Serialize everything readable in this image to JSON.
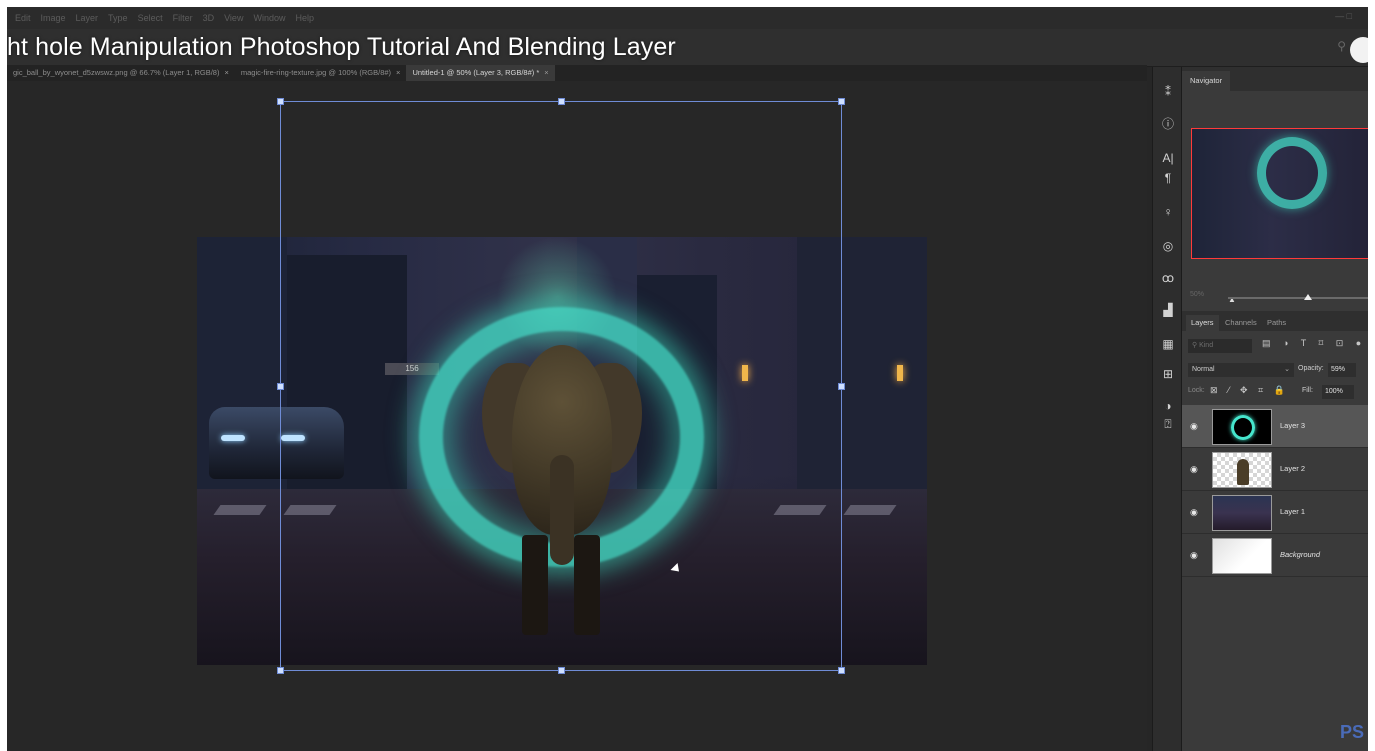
{
  "menu": [
    "Edit",
    "Image",
    "Layer",
    "Type",
    "Select",
    "Filter",
    "3D",
    "View",
    "Window",
    "Help"
  ],
  "window_controls": "— □",
  "video_title": "ht hole Manipulation Photoshop Tutorial And Blending Layer",
  "tabs": [
    {
      "label": "gic_ball_by_wyonet_d5zwswz.png @ 66.7% (Layer 1, RGB/8)",
      "close": "×",
      "active": false
    },
    {
      "label": "magic-fire-ring-texture.jpg @ 100% (RGB/8#)",
      "close": "×",
      "active": false
    },
    {
      "label": "Untitled-1 @ 50% (Layer 3, RGB/8#) *",
      "close": "×",
      "active": true
    }
  ],
  "canvas": {
    "street_sign": "156"
  },
  "tools": [
    {
      "icon": "history-icon",
      "glyph": "⁑"
    },
    {
      "icon": "info-icon",
      "glyph": "ⓘ"
    },
    {
      "icon": "character-icon",
      "glyph": "A|"
    },
    {
      "icon": "paragraph-icon",
      "glyph": "¶"
    },
    {
      "icon": "learn-icon",
      "glyph": "♀"
    },
    {
      "icon": "libraries-icon",
      "glyph": "◎"
    },
    {
      "icon": "adjust-icon",
      "glyph": "ꝏ"
    },
    {
      "icon": "histogram-icon",
      "glyph": "▟"
    },
    {
      "icon": "swatches-icon",
      "glyph": "▦"
    },
    {
      "icon": "properties-icon",
      "glyph": "⊞"
    },
    {
      "icon": "adjustments-icon",
      "glyph": "◑"
    },
    {
      "icon": "paths-icon",
      "glyph": "⍰"
    }
  ],
  "navigator": {
    "tab": "Navigator",
    "zoom": "50%"
  },
  "layers_panel": {
    "tabs": [
      "Layers",
      "Channels",
      "Paths"
    ],
    "active_tab": "Layers",
    "filter_placeholder": "Kind",
    "filter_icons": "▤ ◑ T ⌑ ⊡ ●",
    "blend_mode": "Normal",
    "opacity_label": "Opacity:",
    "opacity": "59%",
    "lock_label": "Lock:",
    "lock_icons": "⊠ ⁄ ✥ ⌗ 🔒",
    "fill_label": "Fill:",
    "fill": "100%",
    "layers": [
      {
        "name": "Layer 3",
        "thumb": "ring",
        "selected": true
      },
      {
        "name": "Layer 2",
        "thumb": "elephant",
        "selected": false
      },
      {
        "name": "Layer 1",
        "thumb": "street",
        "selected": false
      },
      {
        "name": "Background",
        "thumb": "white",
        "selected": false
      }
    ]
  },
  "watermark": "PS"
}
